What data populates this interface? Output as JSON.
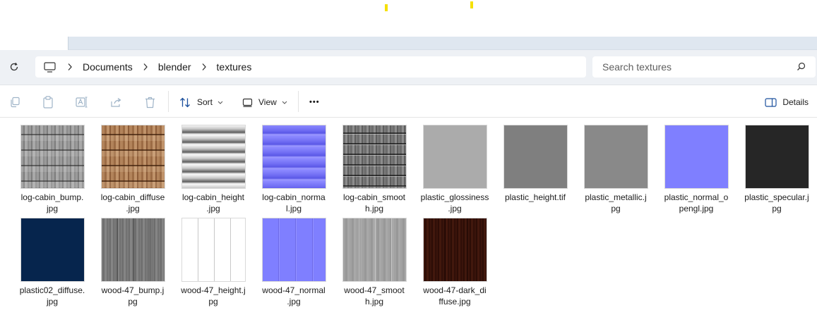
{
  "window": {
    "accent_color": "#f5e000",
    "address_row_color": "#eef1f5"
  },
  "address_bar": {
    "root_icon": "this-pc-icon",
    "breadcrumbs": [
      "Documents",
      "blender",
      "textures"
    ]
  },
  "search": {
    "placeholder": "Search textures",
    "value": ""
  },
  "toolbar": {
    "icons": [
      "copy-icon",
      "paste-icon",
      "rename-icon",
      "share-icon",
      "delete-icon"
    ],
    "sort_label": "Sort",
    "view_label": "View",
    "more_label": "•••",
    "details_label": "Details"
  },
  "files": [
    {
      "name": "log-cabin_bump.jpg",
      "label_line1": "log-cabin_bump.",
      "label_line2": "jpg",
      "thumb_style": "t-bump"
    },
    {
      "name": "log-cabin_diffuse.jpg",
      "label_line1": "log-cabin_diffuse",
      "label_line2": ".jpg",
      "thumb_style": "t-diffuse"
    },
    {
      "name": "log-cabin_height.jpg",
      "label_line1": "log-cabin_height",
      "label_line2": ".jpg",
      "thumb_style": "t-height"
    },
    {
      "name": "log-cabin_normal.jpg",
      "label_line1": "log-cabin_norma",
      "label_line2": "l.jpg",
      "thumb_style": "t-normal"
    },
    {
      "name": "log-cabin_smooth.jpg",
      "label_line1": "log-cabin_smoot",
      "label_line2": "h.jpg",
      "thumb_style": "t-smooth"
    },
    {
      "name": "plastic_glossiness.jpg",
      "label_line1": "plastic_glossiness",
      "label_line2": ".jpg",
      "thumb_style": "t-plastic-gloss"
    },
    {
      "name": "plastic_height.tif",
      "label_line1": "plastic_height.tif",
      "label_line2": "",
      "thumb_style": "t-plastic-height"
    },
    {
      "name": "plastic_metallic.jpg",
      "label_line1": "plastic_metallic.j",
      "label_line2": "pg",
      "thumb_style": "t-plastic-metal"
    },
    {
      "name": "plastic_normal_opengl.jpg",
      "label_line1": "plastic_normal_o",
      "label_line2": "pengl.jpg",
      "thumb_style": "t-plastic-normal"
    },
    {
      "name": "plastic_specular.jpg",
      "label_line1": "plastic_specular.j",
      "label_line2": "pg",
      "thumb_style": "t-plastic-spec"
    },
    {
      "name": "plastic02_diffuse.jpg",
      "label_line1": "plastic02_diffuse.",
      "label_line2": "jpg",
      "thumb_style": "t-plastic02"
    },
    {
      "name": "wood-47_bump.jpg",
      "label_line1": "wood-47_bump.j",
      "label_line2": "pg",
      "thumb_style": "t-wood-bump"
    },
    {
      "name": "wood-47_height.jpg",
      "label_line1": "wood-47_height.j",
      "label_line2": "pg",
      "thumb_style": "t-wood-height"
    },
    {
      "name": "wood-47_normal.jpg",
      "label_line1": "wood-47_normal",
      "label_line2": ".jpg",
      "thumb_style": "t-wood-normal"
    },
    {
      "name": "wood-47_smooth.jpg",
      "label_line1": "wood-47_smoot",
      "label_line2": "h.jpg",
      "thumb_style": "t-wood-smooth"
    },
    {
      "name": "wood-47-dark_diffuse.jpg",
      "label_line1": "wood-47-dark_di",
      "label_line2": "ffuse.jpg",
      "thumb_style": "t-wood-dark"
    }
  ]
}
